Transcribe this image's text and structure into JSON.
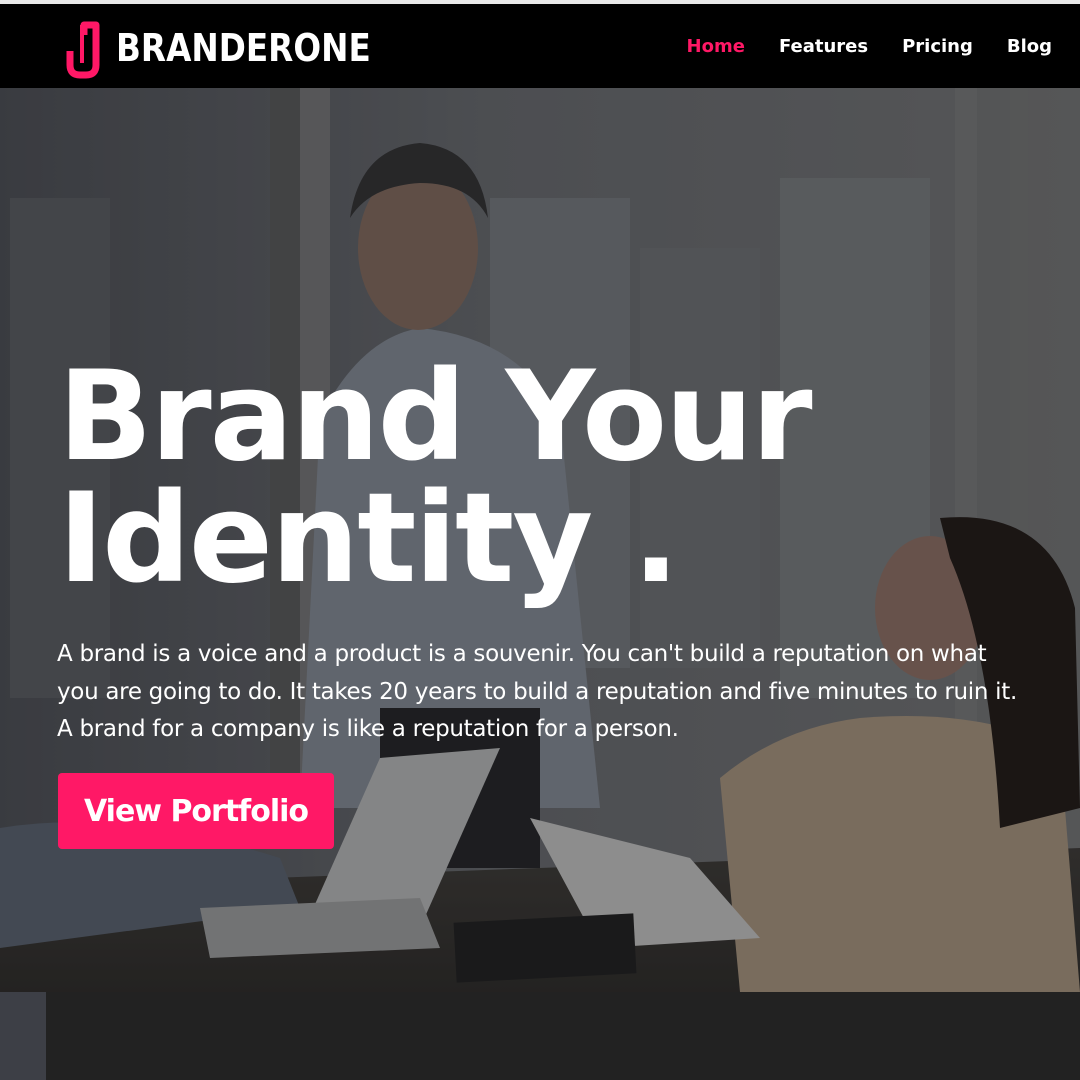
{
  "brand": {
    "name": "BRANDERONE",
    "logo_icon": "j-lettermark-icon",
    "accent_color": "#ff1866"
  },
  "nav": {
    "items": [
      {
        "label": "Home",
        "active": true
      },
      {
        "label": "Features",
        "active": false
      },
      {
        "label": "Pricing",
        "active": false
      },
      {
        "label": "Blog",
        "active": false
      }
    ]
  },
  "hero": {
    "headline_line1": "Brand Your",
    "headline_line2": "Identity .",
    "tagline_line1": "A brand is a voice and a product is a souvenir. You can't build a reputation on what",
    "tagline_line2": "you are going to do. It takes 20 years to build a reputation and five minutes to ruin it.",
    "tagline_line3": "A brand for a company is like a reputation for a person.",
    "cta_label": "View Portfolio",
    "background_image": "office-meeting-photo"
  }
}
